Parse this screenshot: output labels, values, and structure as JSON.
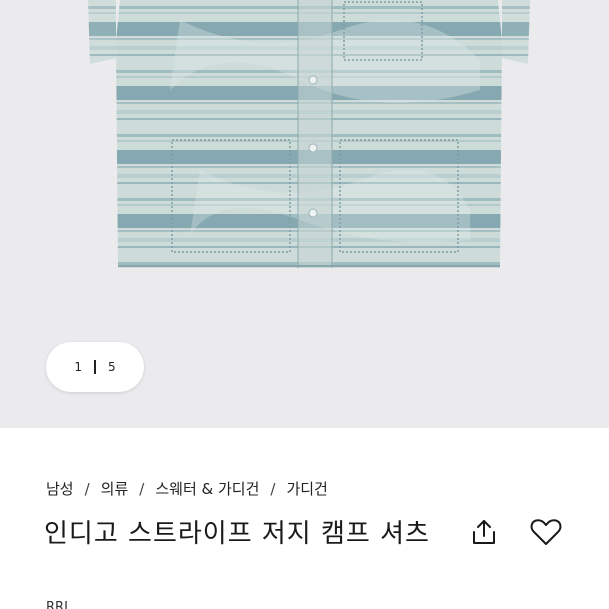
{
  "gallery": {
    "current_index": "1",
    "total": "5"
  },
  "breadcrumb": {
    "items": [
      "남성",
      "의류",
      "스웨터 & 가디건",
      "가디건"
    ],
    "separator": "/"
  },
  "product": {
    "title": "인디고 스트라이프 저지 캠프 셔츠",
    "brand": "RRL"
  },
  "actions": {
    "share_icon": "share-icon",
    "like_icon": "heart-icon"
  },
  "colors": {
    "gallery_bg": "#ebebed",
    "text": "#1a1a1a",
    "shirt_light": "#c9d8d6",
    "shirt_indigo": "#7fa3ab"
  }
}
